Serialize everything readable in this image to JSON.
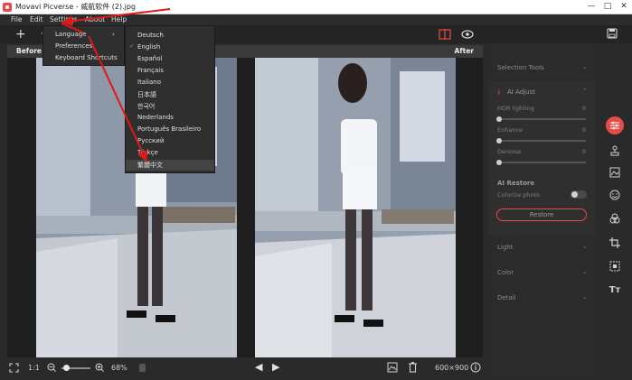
{
  "window": {
    "title": "Movavi Picverse - 威航软件 (2).jpg",
    "minimize": "—",
    "maximize": "□",
    "close": "✕"
  },
  "menubar": {
    "items": [
      "File",
      "Edit",
      "Settings",
      "About",
      "Help"
    ]
  },
  "settings_menu": {
    "items": [
      {
        "label": "Language",
        "arrow": "›"
      },
      {
        "label": "Preferences"
      },
      {
        "label": "Keyboard Shortcuts"
      }
    ]
  },
  "language_menu": {
    "items": [
      "Deutsch",
      "English",
      "Español",
      "Français",
      "Italiano",
      "日本語",
      "한국어",
      "Nederlands",
      "Português Brasileiro",
      "Русский",
      "Türkçe",
      "繁體中文"
    ],
    "checked": "English",
    "check_glyph": "✓",
    "highlighted": "繁體中文"
  },
  "compare": {
    "before_label": "Before",
    "after_label": "After"
  },
  "bottom": {
    "ratio_label": "1:1",
    "zoom_value": 68,
    "zoom_text": "68%",
    "image_size": "600×900"
  },
  "right_panel": {
    "selection_tools": "Selection Tools",
    "ai_adjust": "AI Adjust",
    "sliders": [
      {
        "label": "HDR lighting",
        "value": "0"
      },
      {
        "label": "Enhance",
        "value": "0"
      },
      {
        "label": "Denoise",
        "value": "0"
      }
    ],
    "ai_restore": "AI Restore",
    "colorize_label": "Colorize photo",
    "colorize_on": false,
    "restore_button": "Restore",
    "light": "Light",
    "color": "Color",
    "detail": "Detail"
  },
  "tools": [
    "sliders-icon",
    "stamp-icon",
    "image-icon",
    "face-icon",
    "color-circles-icon",
    "crop-icon",
    "frame-icon",
    "text-icon"
  ],
  "colors": {
    "accent": "#e94a4a",
    "annotation": "#e01818",
    "panel": "#2b2b2b",
    "menu": "#2f2f2f"
  }
}
